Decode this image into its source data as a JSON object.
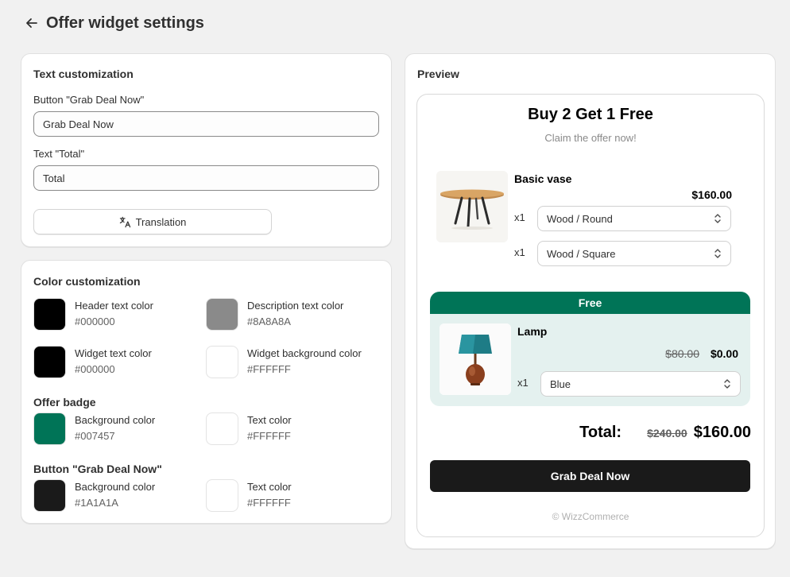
{
  "header": {
    "title": "Offer widget settings"
  },
  "text_customization": {
    "title": "Text customization",
    "button_label": "Button \"Grab Deal Now\"",
    "button_value": "Grab Deal Now",
    "total_label": "Text \"Total\"",
    "total_value": "Total",
    "translation_button": "Translation"
  },
  "color_customization": {
    "title": "Color customization",
    "header_text": {
      "name": "Header text color",
      "hex": "#000000"
    },
    "description_text": {
      "name": "Description text color",
      "hex": "#8A8A8A"
    },
    "widget_text": {
      "name": "Widget text color",
      "hex": "#000000"
    },
    "widget_background": {
      "name": "Widget background color",
      "hex": "#FFFFFF"
    },
    "offer_badge": {
      "title": "Offer badge",
      "background": {
        "name": "Background color",
        "hex": "#007457"
      },
      "text": {
        "name": "Text color",
        "hex": "#FFFFFF"
      }
    },
    "grab_button": {
      "title": "Button \"Grab Deal Now\"",
      "background": {
        "name": "Background color",
        "hex": "#1A1A1A"
      },
      "text": {
        "name": "Text color",
        "hex": "#FFFFFF"
      }
    }
  },
  "preview": {
    "title": "Preview",
    "widget_title": "Buy 2 Get 1 Free",
    "widget_description": "Claim the offer now!",
    "product": {
      "name": "Basic vase",
      "price": "$160.00",
      "variants": [
        {
          "qty": "x1",
          "value": "Wood / Round"
        },
        {
          "qty": "x1",
          "value": "Wood / Square"
        }
      ]
    },
    "free_badge": "Free",
    "free_product": {
      "name": "Lamp",
      "old_price": "$80.00",
      "price": "$0.00",
      "qty": "x1",
      "variant": "Blue"
    },
    "total_label": "Total:",
    "total_old": "$240.00",
    "total_new": "$160.00",
    "button": "Grab Deal Now",
    "footer": "© WizzCommerce"
  }
}
